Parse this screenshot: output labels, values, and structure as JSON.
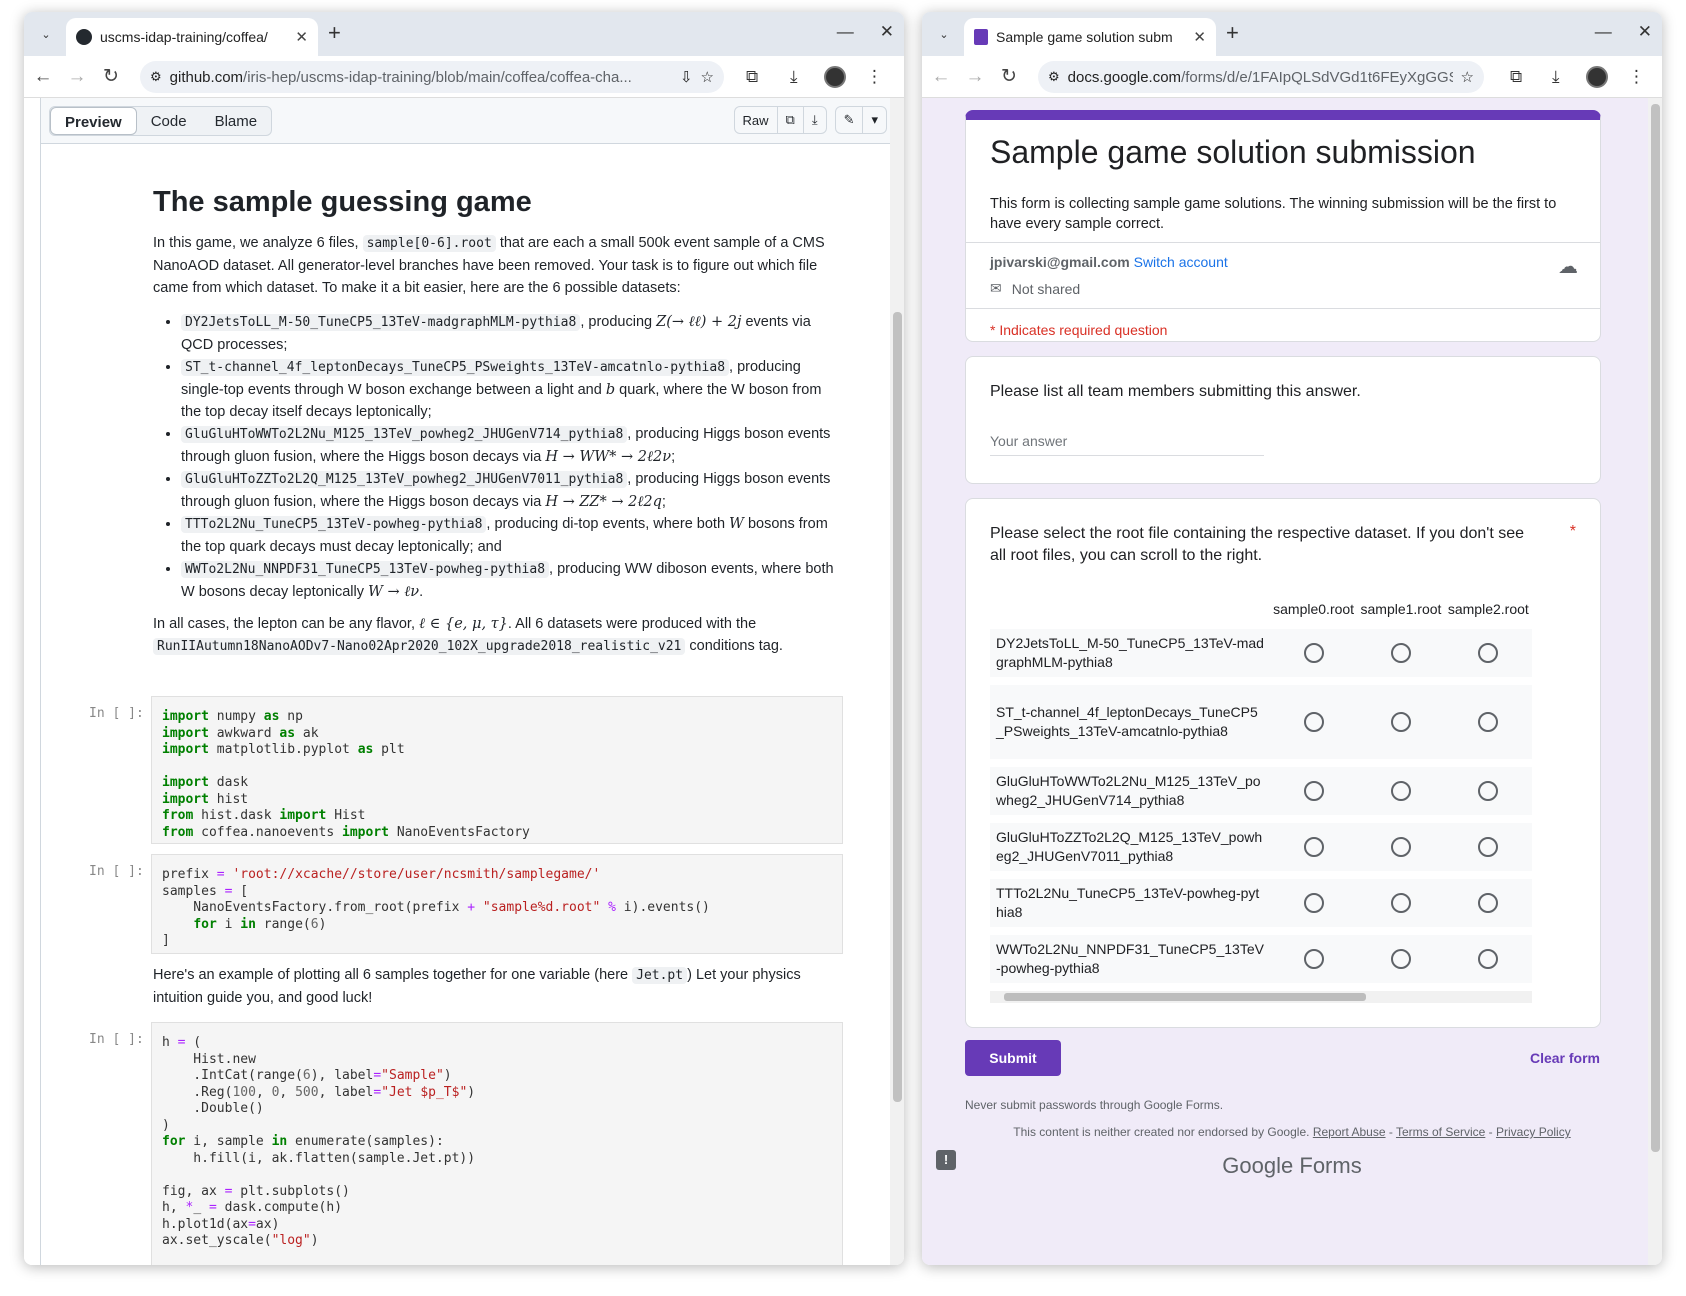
{
  "left": {
    "tab_title": "uscms-idap-training/coffea/",
    "url_host": "github.com",
    "url_path": "/iris-hep/uscms-idap-training/blob/main/coffea/coffea-cha...",
    "view_tabs": [
      "Preview",
      "Code",
      "Blame"
    ],
    "raw_label": "Raw",
    "heading": "The sample guessing game",
    "intro_1": "In this game, we analyze 6 files, ",
    "intro_code": "sample[0-6].root",
    "intro_2": " that are each a small 500k event sample of a CMS NanoAOD dataset. All generator-level branches have been removed. Your task is to figure out which file came from which dataset. To make it a bit easier, here are the 6 possible datasets:",
    "datasets": [
      {
        "code": "DY2JetsToLL_M-50_TuneCP5_13TeV-madgraphMLM-pythia8",
        "pre": ", producing ",
        "math": "Z(→ ℓℓ) + 2j",
        "post": " events via QCD processes;"
      },
      {
        "code": "ST_t-channel_4f_leptonDecays_TuneCP5_PSweights_13TeV-amcatnlo-pythia8",
        "pre": ", producing single-top events through W boson exchange between a light and ",
        "math": "b",
        "post": " quark, where the W boson from the top decay itself decays leptonically;"
      },
      {
        "code": "GluGluHToWWTo2L2Nu_M125_13TeV_powheg2_JHUGenV714_pythia8",
        "pre": ", producing Higgs boson events through gluon fusion, where the Higgs boson decays via ",
        "math": "H → WW* → 2ℓ2ν",
        "post": ";"
      },
      {
        "code": "GluGluHToZZTo2L2Q_M125_13TeV_powheg2_JHUGenV7011_pythia8",
        "pre": ", producing Higgs boson events through gluon fusion, where the Higgs boson decays via ",
        "math": "H → ZZ* → 2ℓ2q",
        "post": ";"
      },
      {
        "code": "TTTo2L2Nu_TuneCP5_13TeV-powheg-pythia8",
        "pre": ", producing di-top events, where both ",
        "math": "W",
        "post": " bosons from the top quark decays must decay leptonically; and"
      },
      {
        "code": "WWTo2L2Nu_NNPDF31_TuneCP5_13TeV-powheg-pythia8",
        "pre": ", producing WW diboson events, where both W bosons decay leptonically ",
        "math": "W → ℓν",
        "post": "."
      }
    ],
    "lepton_1": "In all cases, the lepton can be any flavor, ",
    "lepton_math": "ℓ ∈ {e, μ, τ}",
    "lepton_2": ". All 6 datasets were produced with the ",
    "lepton_code": "RunIIAutumn18NanoAODv7-Nano02Apr2020_102X_upgrade2018_realistic_v21",
    "lepton_3": " conditions tag.",
    "prompt": "In [ ]:",
    "example_1": "Here's an example of plotting all 6 samples together for one variable (here ",
    "example_code": "Jet.pt",
    "example_2": ") Let your physics intuition guide you, and good luck!"
  },
  "right": {
    "tab_title": "Sample game solution subm",
    "url_host": "docs.google.com",
    "url_path": "/forms/d/e/1FAIpQLSdVGd1t6FEyXgGGS...",
    "form_title": "Sample game solution submission",
    "form_desc": "This form is collecting sample game solutions. The winning submission will be the first to have every sample correct.",
    "email": "jpivarski@gmail.com",
    "switch_account": "Switch account",
    "not_shared": "Not shared",
    "required_note": "* Indicates required question",
    "q1_title": "Please list all team members submitting this answer.",
    "q1_placeholder": "Your answer",
    "q2_title": "Please select the root file containing the respective dataset. If you don't see all root files, you can scroll to the right.",
    "q2_star": "*",
    "columns": [
      "sample0.root",
      "sample1.root",
      "sample2.root"
    ],
    "rows": [
      "DY2JetsToLL_M-50_TuneCP5_13TeV-madgraphMLM-pythia8",
      "ST_t-channel_4f_leptonDecays_TuneCP5_PSweights_13TeV-amcatnlo-pythia8",
      "GluGluHToWWTo2L2Nu_M125_13TeV_powheg2_JHUGenV714_pythia8",
      "GluGluHToZZTo2L2Q_M125_13TeV_powheg2_JHUGenV7011_pythia8",
      "TTTo2L2Nu_TuneCP5_13TeV-powheg-pythia8",
      "WWTo2L2Nu_NNPDF31_TuneCP5_13TeV-powheg-pythia8"
    ],
    "submit": "Submit",
    "clear": "Clear form",
    "never": "Never submit passwords through Google Forms.",
    "disclaimer": "This content is neither created nor endorsed by Google.",
    "report": "Report Abuse",
    "tos": "Terms of Service",
    "privacy": "Privacy Policy",
    "logo_google": "Google",
    "logo_forms": "Forms"
  }
}
